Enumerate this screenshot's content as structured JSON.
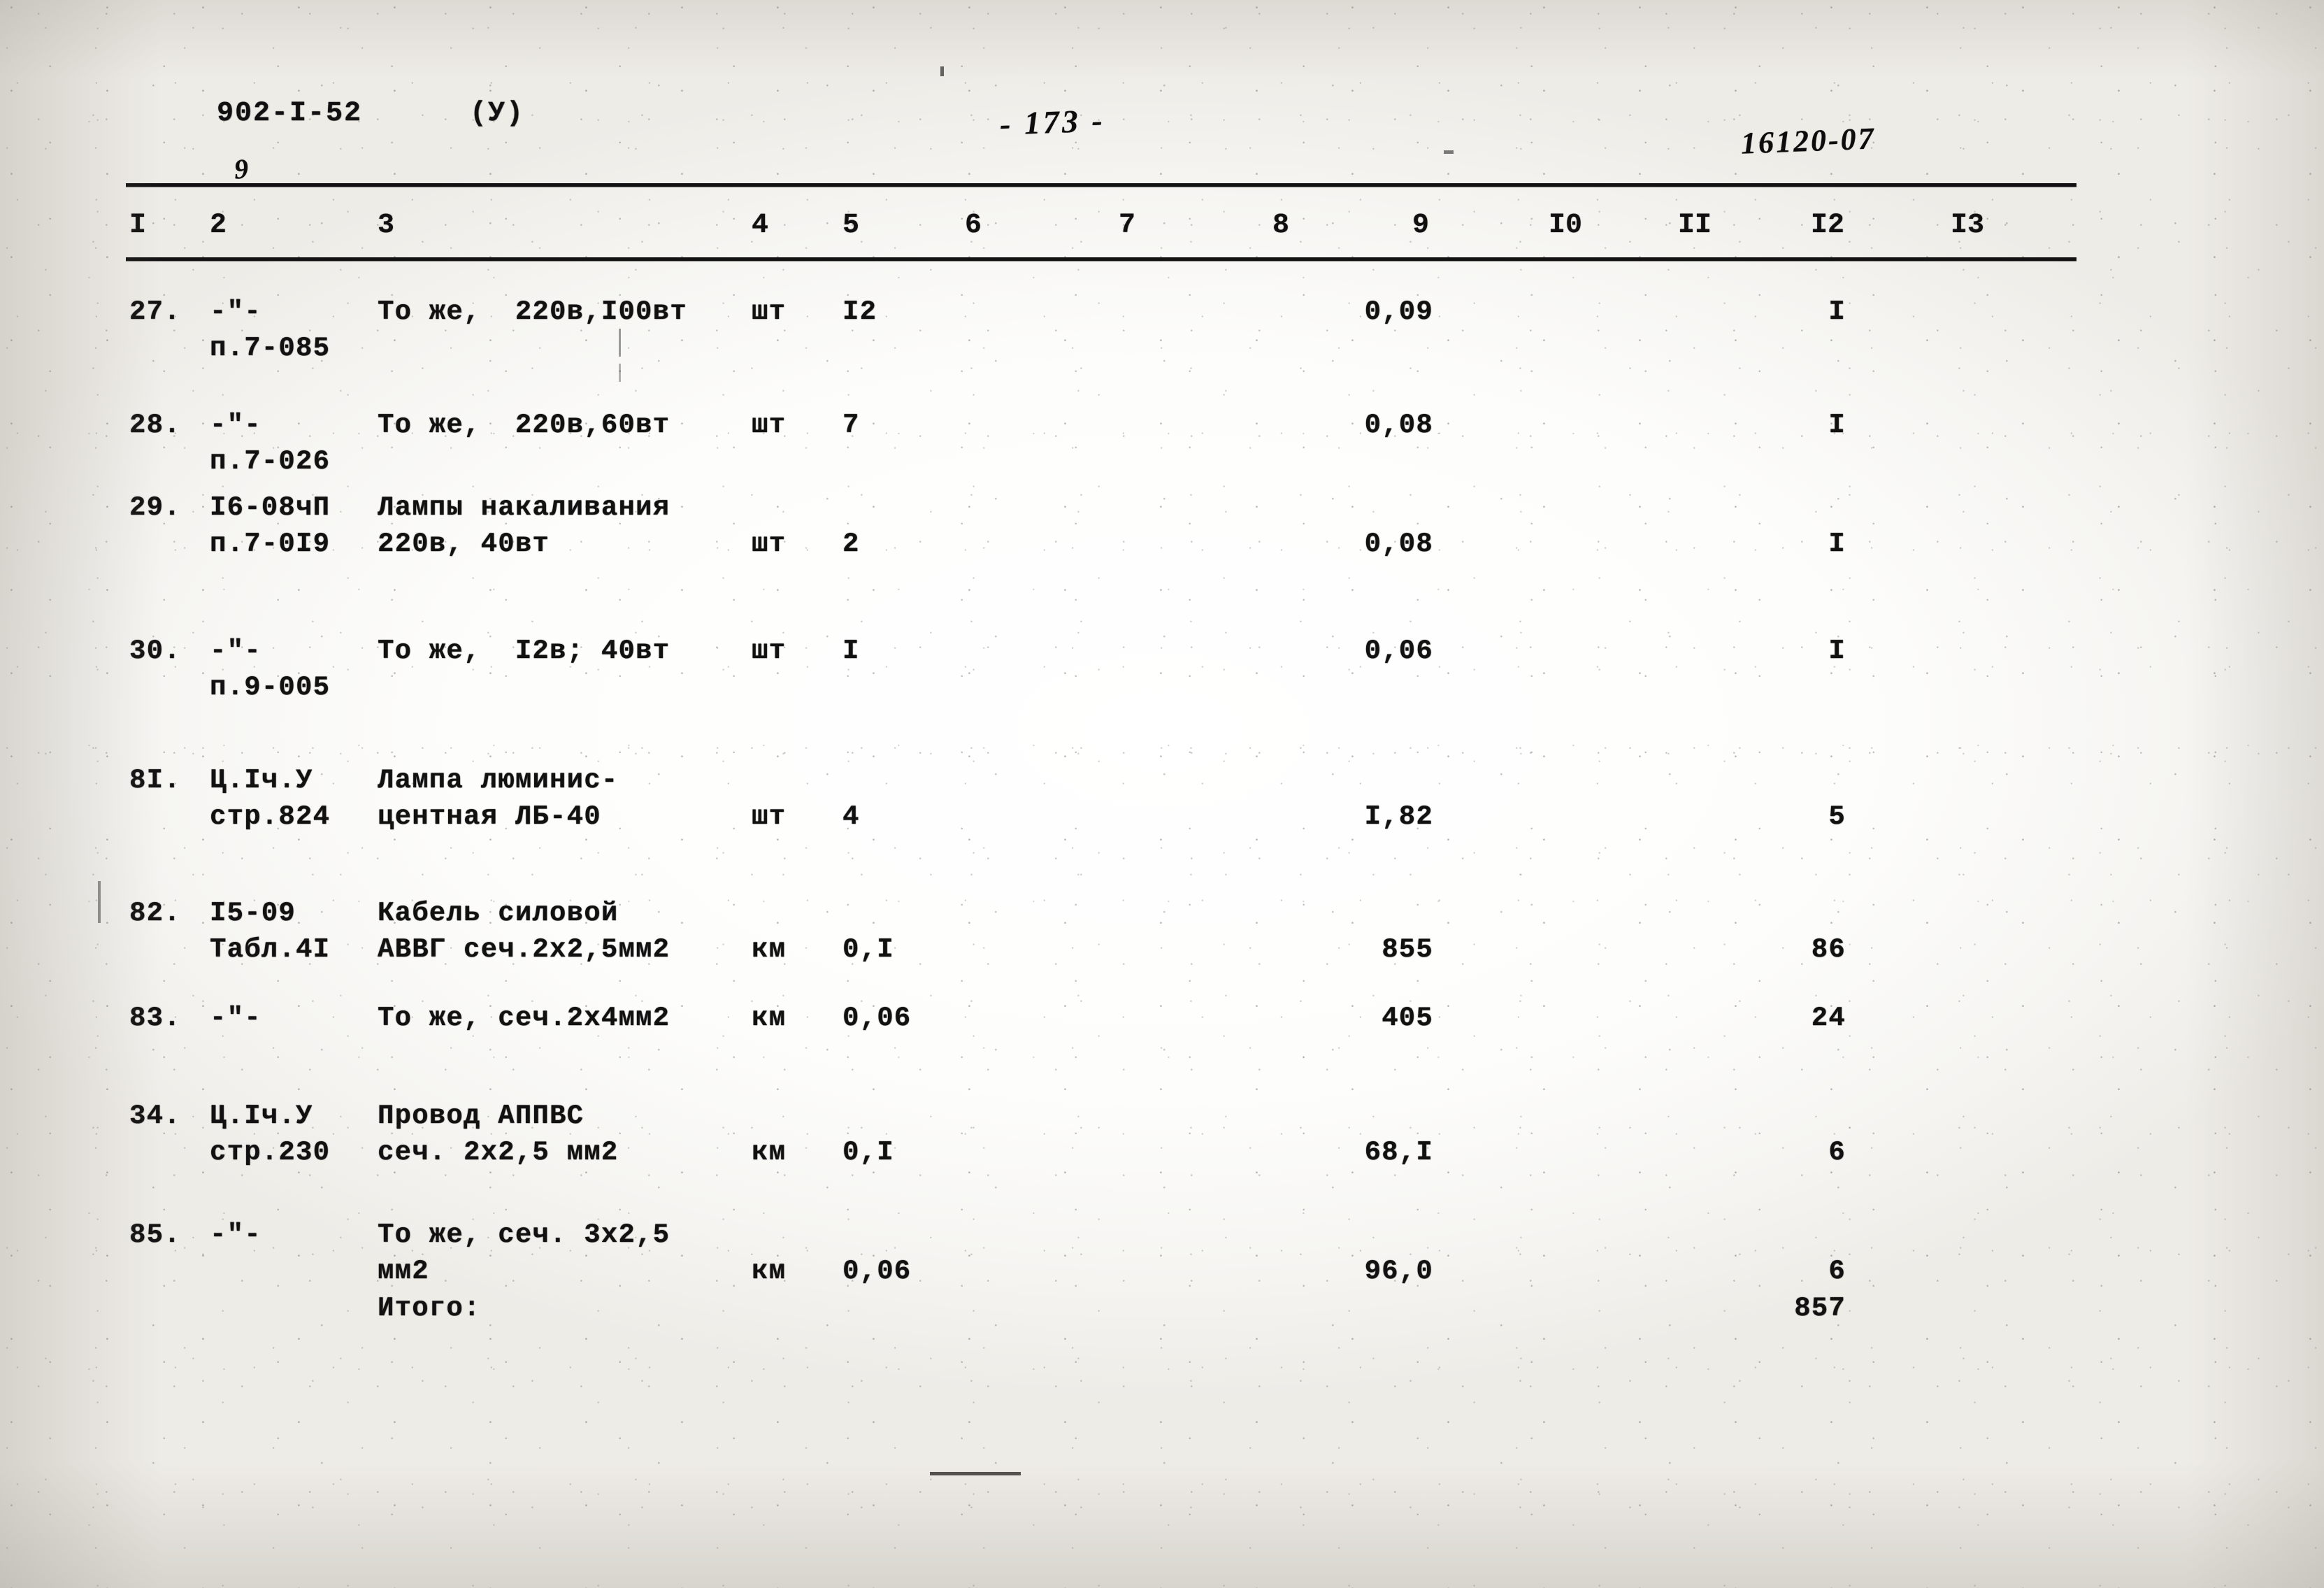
{
  "header": {
    "doc_code": "902-I-52",
    "doc_code_suffix": "(У)",
    "page_number": "- 173 -",
    "sheet_code": "16120-07",
    "col9_note": "9"
  },
  "table": {
    "column_headers": [
      "I",
      "2",
      "3",
      "4",
      "5",
      "6",
      "7",
      "8",
      "9",
      "I0",
      "II",
      "I2",
      "I3"
    ],
    "rows": [
      {
        "num": "27.",
        "code": [
          "-\"-",
          "п.7-085"
        ],
        "name": [
          "То же,  220в,I00вт"
        ],
        "unit": "шт",
        "qty": "I2",
        "value": "0,09",
        "total": "I"
      },
      {
        "num": "28.",
        "code": [
          "-\"-",
          "п.7-026"
        ],
        "name": [
          "То же,  220в,60вт"
        ],
        "unit": "шт",
        "qty": "7",
        "value": "0,08",
        "total": "I"
      },
      {
        "num": "29.",
        "code": [
          "I6-08чП",
          "п.7-0I9"
        ],
        "name": [
          "Лампы накаливания",
          "220в, 40вт"
        ],
        "unit": "шт",
        "qty": "2",
        "value": "0,08",
        "total": "I"
      },
      {
        "num": "30.",
        "code": [
          "-\"-",
          "п.9-005"
        ],
        "name": [
          "То же,  I2в; 40вт"
        ],
        "unit": "шт",
        "qty": "I",
        "value": "0,06",
        "total": "I"
      },
      {
        "num": "8I.",
        "code": [
          "Ц.Iч.У",
          "стр.824"
        ],
        "name": [
          "Лампа люминис-",
          "центная ЛБ-40"
        ],
        "unit": "шт",
        "qty": "4",
        "value": "I,82",
        "total": "5"
      },
      {
        "num": "82.",
        "code": [
          "I5-09",
          "Табл.4I"
        ],
        "name": [
          "Кабель силовой",
          "АВВГ сеч.2х2,5мм2"
        ],
        "unit": "км",
        "qty": "0,I",
        "value": "855",
        "total": "86"
      },
      {
        "num": "83.",
        "code": [
          "-\"-"
        ],
        "name": [
          "То же, сеч.2х4мм2"
        ],
        "unit": "км",
        "qty": "0,06",
        "value": "405",
        "total": "24"
      },
      {
        "num": "34.",
        "code": [
          "Ц.Iч.У",
          "стр.230"
        ],
        "name": [
          "Провод АППВС",
          "сеч. 2х2,5 мм2"
        ],
        "unit": "км",
        "qty": "0,I",
        "value": "68,I",
        "total": "6"
      },
      {
        "num": "85.",
        "code": [
          "-\"-"
        ],
        "name": [
          "То же, сеч. 3х2,5",
          "мм2"
        ],
        "unit": "км",
        "qty": "0,06",
        "value": "96,0",
        "total": "6"
      }
    ],
    "total_row": {
      "label": "Итого:",
      "total": "857"
    }
  }
}
